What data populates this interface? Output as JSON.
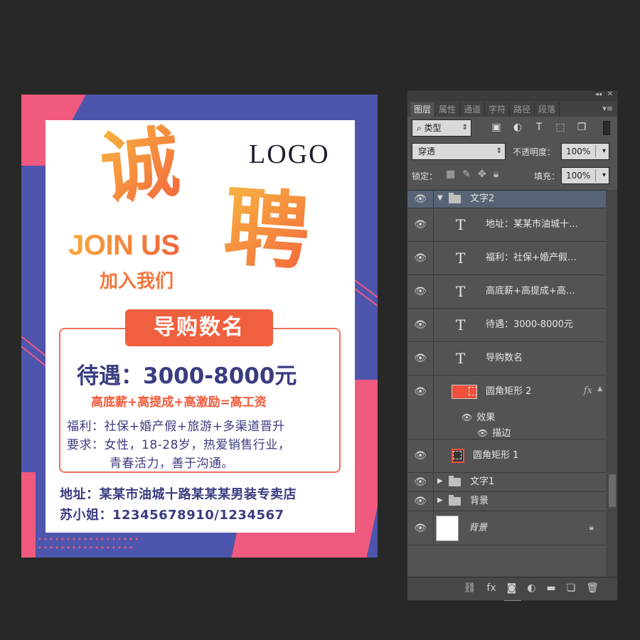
{
  "poster": {
    "title_char_1": "诚",
    "title_char_2": "聘",
    "logo": "LOGO",
    "join_us_en": "JOIN US",
    "join_us_cn": "加入我们",
    "position": "导购数名",
    "salary": "待遇：3000-8000元",
    "slogan": "高底薪+高提成+高激励=高工资",
    "benefits": "福利：社保+婚产假+旅游+多渠道晋升",
    "requirements_line1": "要求：女性，18-28岁，热爱销售行业，",
    "requirements_line2": "青春活力，善于沟通。",
    "address": "地址：某某市油城十路某某某男装专卖店",
    "contact": "苏小姐：12345678910/1234567",
    "colors": {
      "blue": "#4e55ad",
      "pink": "#f05a7e",
      "orange": "#f0603f",
      "text_blue": "#3b3c80"
    }
  },
  "layers_panel": {
    "tabs": [
      "图层",
      "属性",
      "通道",
      "字符",
      "路径",
      "段落"
    ],
    "active_tab": "图层",
    "filter_type": "类型",
    "blend_mode": "穿透",
    "opacity_label": "不透明度：",
    "opacity": "100%",
    "lock_label": "锁定：",
    "fill_label": "填充：",
    "fill": "100%",
    "layers": [
      {
        "name": "文字2",
        "kind": "group",
        "expanded": true
      },
      {
        "name": "地址：某某市油城十…",
        "kind": "text"
      },
      {
        "name": "福利：社保+婚产假…",
        "kind": "text"
      },
      {
        "name": "高底薪+高提成+高…",
        "kind": "text"
      },
      {
        "name": "待遇：3000-8000元",
        "kind": "text"
      },
      {
        "name": "导购数名",
        "kind": "text"
      },
      {
        "name": "圆角矩形 2",
        "kind": "shape",
        "fx": "fx",
        "effects_label": "效果",
        "effect": "描边"
      },
      {
        "name": "圆角矩形 1",
        "kind": "shape"
      },
      {
        "name": "文字1",
        "kind": "group",
        "expanded": false
      },
      {
        "name": "背景",
        "kind": "group",
        "expanded": false
      },
      {
        "name": "背景",
        "kind": "background",
        "locked": true
      }
    ]
  }
}
